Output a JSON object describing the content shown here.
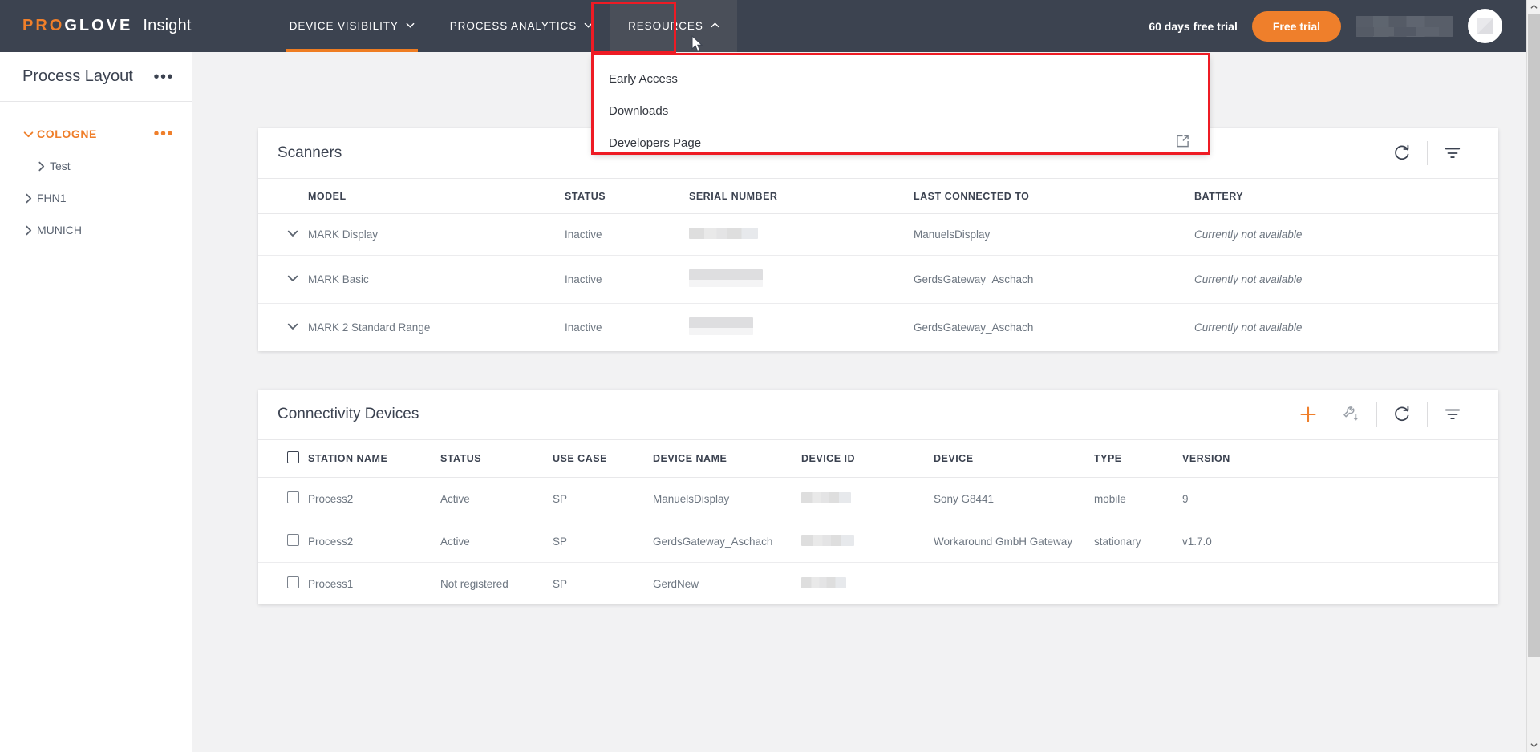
{
  "header": {
    "brand_pro": "PRO",
    "brand_glove": "GLOVE",
    "brand_product": "Insight",
    "nav": [
      {
        "label": "DEVICE VISIBILITY",
        "icon": "chevron-down-icon",
        "state": "active"
      },
      {
        "label": "PROCESS ANALYTICS",
        "icon": "chevron-down-icon",
        "state": "default"
      },
      {
        "label": "RESOURCES",
        "icon": "chevron-up-icon",
        "state": "open"
      }
    ],
    "trial_text": "60 days free trial",
    "trial_button": "Free trial",
    "account_icon": "avatar",
    "accent_color": "#ef7f2b",
    "bar_color": "#3c4350"
  },
  "dropdown": {
    "items": [
      {
        "label": "Early Access",
        "icon": ""
      },
      {
        "label": "Downloads",
        "icon": ""
      },
      {
        "label": "Developers Page",
        "icon": "external-link-icon"
      }
    ]
  },
  "annotation": {
    "color": "#ee1b24"
  },
  "sidebar": {
    "title": "Process Layout",
    "menu_icon": "more-options-icon",
    "tree": [
      {
        "label": "COLOGNE",
        "level": 0,
        "expanded": true,
        "menu": true,
        "icon": "chevron-down-icon"
      },
      {
        "label": "Test",
        "level": 1,
        "expanded": false,
        "menu": false,
        "icon": "chevron-right-icon"
      },
      {
        "label": "FHN1",
        "level": 0,
        "expanded": false,
        "menu": false,
        "icon": "chevron-right-icon"
      },
      {
        "label": "MUNICH",
        "level": 0,
        "expanded": false,
        "menu": false,
        "icon": "chevron-right-icon"
      }
    ]
  },
  "scanners": {
    "title": "Scanners",
    "actions": [
      {
        "name": "refresh-icon",
        "label": "Refresh"
      },
      {
        "name": "filter-icon",
        "label": "Filter"
      }
    ],
    "columns": [
      "MODEL",
      "STATUS",
      "SERIAL NUMBER",
      "LAST CONNECTED TO",
      "BATTERY"
    ],
    "rows": [
      {
        "model": "MARK Display",
        "status": "Inactive",
        "serial": "",
        "last_connected": "ManuelsDisplay",
        "battery": "Currently not available"
      },
      {
        "model": "MARK Basic",
        "status": "Inactive",
        "serial": "",
        "last_connected": "GerdsGateway_Aschach",
        "battery": "Currently not available"
      },
      {
        "model": "MARK 2 Standard Range",
        "status": "Inactive",
        "serial": "",
        "last_connected": "GerdsGateway_Aschach",
        "battery": "Currently not available"
      }
    ]
  },
  "connectivity": {
    "title": "Connectivity Devices",
    "actions": [
      {
        "name": "add-icon",
        "label": "Add"
      },
      {
        "name": "configure-download-icon",
        "label": "Configure"
      },
      {
        "name": "refresh-icon",
        "label": "Refresh"
      },
      {
        "name": "filter-icon",
        "label": "Filter"
      }
    ],
    "columns": [
      "STATION NAME",
      "STATUS",
      "USE CASE",
      "DEVICE NAME",
      "DEVICE ID",
      "DEVICE",
      "TYPE",
      "VERSION"
    ],
    "rows": [
      {
        "station": "Process2",
        "status": "Active",
        "status_type": "active",
        "use_case": "SP",
        "device_name": "ManuelsDisplay",
        "device_id": "",
        "device": "Sony G8441",
        "type": "mobile",
        "version": "9"
      },
      {
        "station": "Process2",
        "status": "Active",
        "status_type": "active",
        "use_case": "SP",
        "device_name": "GerdsGateway_Aschach",
        "device_id": "",
        "device": "Workaround GmbH Gateway",
        "type": "stationary",
        "version": "v1.7.0"
      },
      {
        "station": "Process1",
        "status": "Not registered",
        "status_type": "notreg",
        "use_case": "SP",
        "device_name": "GerdNew",
        "device_id": "",
        "device": "",
        "type": "",
        "version": ""
      }
    ],
    "status_colors": {
      "active": "#2a9b5d",
      "notreg": "#e0323c"
    }
  }
}
